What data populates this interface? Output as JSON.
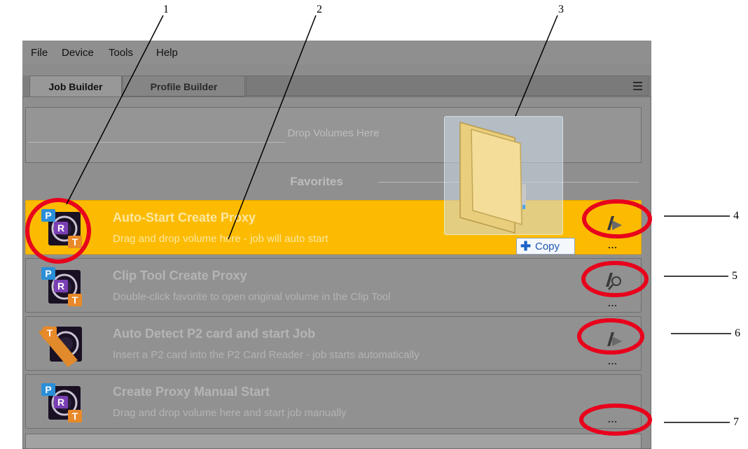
{
  "menu": {
    "file": "File",
    "device": "Device",
    "tools": "Tools",
    "help": "Help"
  },
  "tabs": {
    "job_builder": "Job Builder",
    "profile_builder": "Profile Builder"
  },
  "dropzone": {
    "label": "Drop Volumes Here"
  },
  "favorites": {
    "label": "Favorites",
    "items": [
      {
        "title": "Auto-Start Create Proxy",
        "desc": "Drag and drop volume here - job will auto start",
        "action_icon": "auto-start-icon",
        "selected": true
      },
      {
        "title": "Clip Tool Create Proxy",
        "desc": "Double-click favorite to open original volume in the Clip Tool",
        "action_icon": "clip-tool-icon",
        "selected": false
      },
      {
        "title": "Auto Detect P2 card and start Job",
        "desc": "Insert a P2 card into the P2 Card Reader - job starts automatically",
        "action_icon": "auto-detect-icon",
        "selected": false
      },
      {
        "title": "Create Proxy Manual Start",
        "desc": "Drag and drop volume here and start job manually",
        "action_icon": "none",
        "selected": false
      }
    ],
    "more_label": "..."
  },
  "drag": {
    "copy_label": "Copy"
  },
  "callouts": [
    "1",
    "2",
    "3",
    "4",
    "5",
    "6",
    "7"
  ],
  "colors": {
    "selected_row": "#fcbb00",
    "callout_ring": "#e8001c",
    "panel": "#8f8f8f"
  }
}
